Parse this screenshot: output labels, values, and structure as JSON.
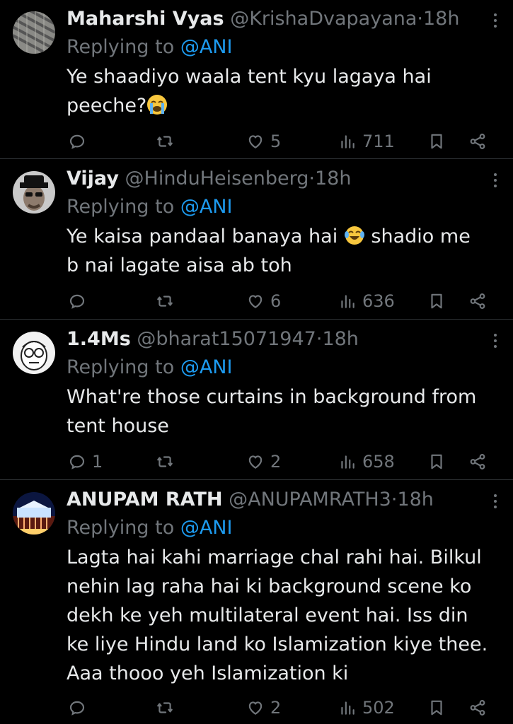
{
  "tweets": [
    {
      "name": "Maharshi Vyas",
      "handle": "@KrishaDvapayana",
      "dot": "·",
      "time": "18h",
      "replying_prefix": "Replying to ",
      "replying_handle": "@ANI",
      "lines": [
        "Ye shaadiyo waala tent kyu lagaya hai",
        "peeche?"
      ],
      "emoji": "loudly-crying-face",
      "replies": "",
      "reposts": "",
      "likes": "5",
      "views": "711"
    },
    {
      "name": "Vijay",
      "handle": "@HinduHeisenberg",
      "dot": "·",
      "time": "18h",
      "replying_prefix": "Replying to ",
      "replying_handle": "@ANI",
      "lines_a": "Ye kaisa pandaal banaya hai",
      "lines_b": "shadio me",
      "line2": "b nai lagate aisa ab toh",
      "emoji": "face-with-tears-of-joy",
      "replies": "",
      "reposts": "",
      "likes": "6",
      "views": "636"
    },
    {
      "name": "1.4Ms",
      "handle": "@bharat15071947",
      "dot": "·",
      "time": "18h",
      "replying_prefix": "Replying to ",
      "replying_handle": "@ANI",
      "lines": [
        "What're those curtains in background from",
        "tent house"
      ],
      "replies": "1",
      "reposts": "",
      "likes": "2",
      "views": "658"
    },
    {
      "name": "ANUPAM RATH",
      "handle": "@ANUPAMRATH3",
      "dot": "·",
      "time": "18h",
      "replying_prefix": "Replying to ",
      "replying_handle": "@ANI",
      "lines": [
        "Lagta hai kahi marriage chal rahi hai. Bilkul",
        "nehin lag raha hai ki background scene ko",
        "dekh ke yeh multilateral event hai. Iss din",
        "ke liye Hindu land ko Islamization kiye thee.",
        "Aaa thooo yeh Islamization ki"
      ],
      "replies": "",
      "reposts": "",
      "likes": "2",
      "views": "502"
    }
  ],
  "colors": {
    "background": "#000000",
    "text": "#e7e9ea",
    "muted": "#71767b",
    "link": "#1d9bf0",
    "divider": "#2f3336"
  },
  "icons": [
    "reply-icon",
    "repost-icon",
    "like-icon",
    "views-icon",
    "bookmark-icon",
    "share-icon",
    "more-icon"
  ]
}
